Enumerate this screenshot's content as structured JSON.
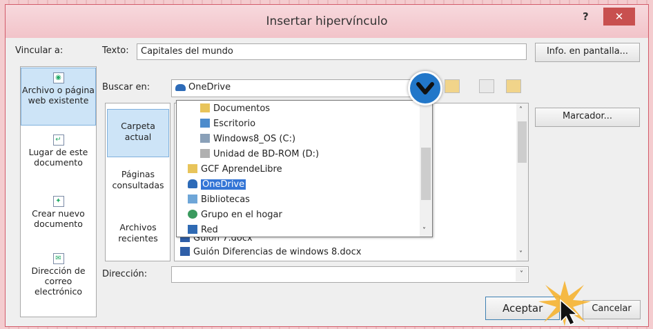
{
  "dialog": {
    "title": "Insertar hipervínculo",
    "help": "?",
    "close": "✕"
  },
  "vincular_label": "Vincular a:",
  "texto": {
    "label": "Texto:",
    "value": "Capitales del mundo"
  },
  "info_button": "Info. en pantalla...",
  "nav": [
    {
      "label": "Archivo o página web existente"
    },
    {
      "label": "Lugar de este documento"
    },
    {
      "label": "Crear nuevo documento"
    },
    {
      "label": "Dirección de correo electrónico"
    }
  ],
  "buscar": {
    "label": "Buscar en:",
    "value": "OneDrive"
  },
  "midnav": [
    {
      "label": "Carpeta actual"
    },
    {
      "label": "Páginas consultadas"
    },
    {
      "label": "Archivos recientes"
    }
  ],
  "dropdown_items": [
    {
      "label": "Documentos",
      "level": 2
    },
    {
      "label": "Escritorio",
      "level": 2
    },
    {
      "label": "Windows8_OS (C:)",
      "level": 2
    },
    {
      "label": "Unidad de BD-ROM (D:)",
      "level": 2
    },
    {
      "label": "GCF AprendeLibre",
      "level": 1
    },
    {
      "label": "OneDrive",
      "level": 1,
      "selected": true
    },
    {
      "label": "Bibliotecas",
      "level": 1
    },
    {
      "label": "Grupo en el hogar",
      "level": 1
    },
    {
      "label": "Red",
      "level": 1
    }
  ],
  "file_list": [
    {
      "label": "Guión 7.docx"
    },
    {
      "label": "Guión Diferencias de windows 8.docx"
    }
  ],
  "marcador_button": "Marcador...",
  "direccion": {
    "label": "Dirección:",
    "value": ""
  },
  "aceptar_button": "Aceptar",
  "cancelar_button": "Cancelar",
  "colors": {
    "accent": "#2277c9",
    "titlebar": "#f2c3c9",
    "close": "#c8504f",
    "selection": "#3375d6"
  }
}
